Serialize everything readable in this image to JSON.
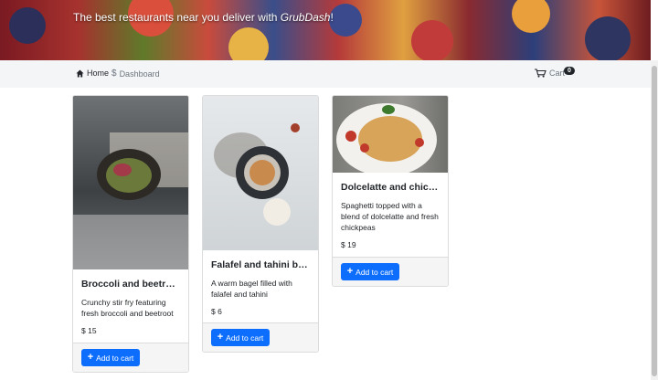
{
  "hero": {
    "text_prefix": "The best restaurants near you deliver with ",
    "brand": "GrubDash",
    "text_suffix": "!"
  },
  "nav": {
    "home_label": "Home",
    "dashboard_label": "Dashboard",
    "cart_label": "Cart",
    "cart_count": "0"
  },
  "products": [
    {
      "title": "Broccoli and beetroot...",
      "description": "Crunchy stir fry featuring fresh broccoli and beetroot",
      "price": "$ 15",
      "button_label": "Add to cart"
    },
    {
      "title": "Falafel and tahini bagel",
      "description": "A warm bagel filled with falafel and tahini",
      "price": "$ 6",
      "button_label": "Add to cart"
    },
    {
      "title": "Dolcelatte and chickp...",
      "description": "Spaghetti topped with a blend of dolcelatte and fresh chickpeas",
      "price": "$ 19",
      "button_label": "Add to cart"
    }
  ],
  "colors": {
    "primary": "#0d6efd",
    "navbar_bg": "#f4f5f7",
    "badge_bg": "#212529"
  }
}
